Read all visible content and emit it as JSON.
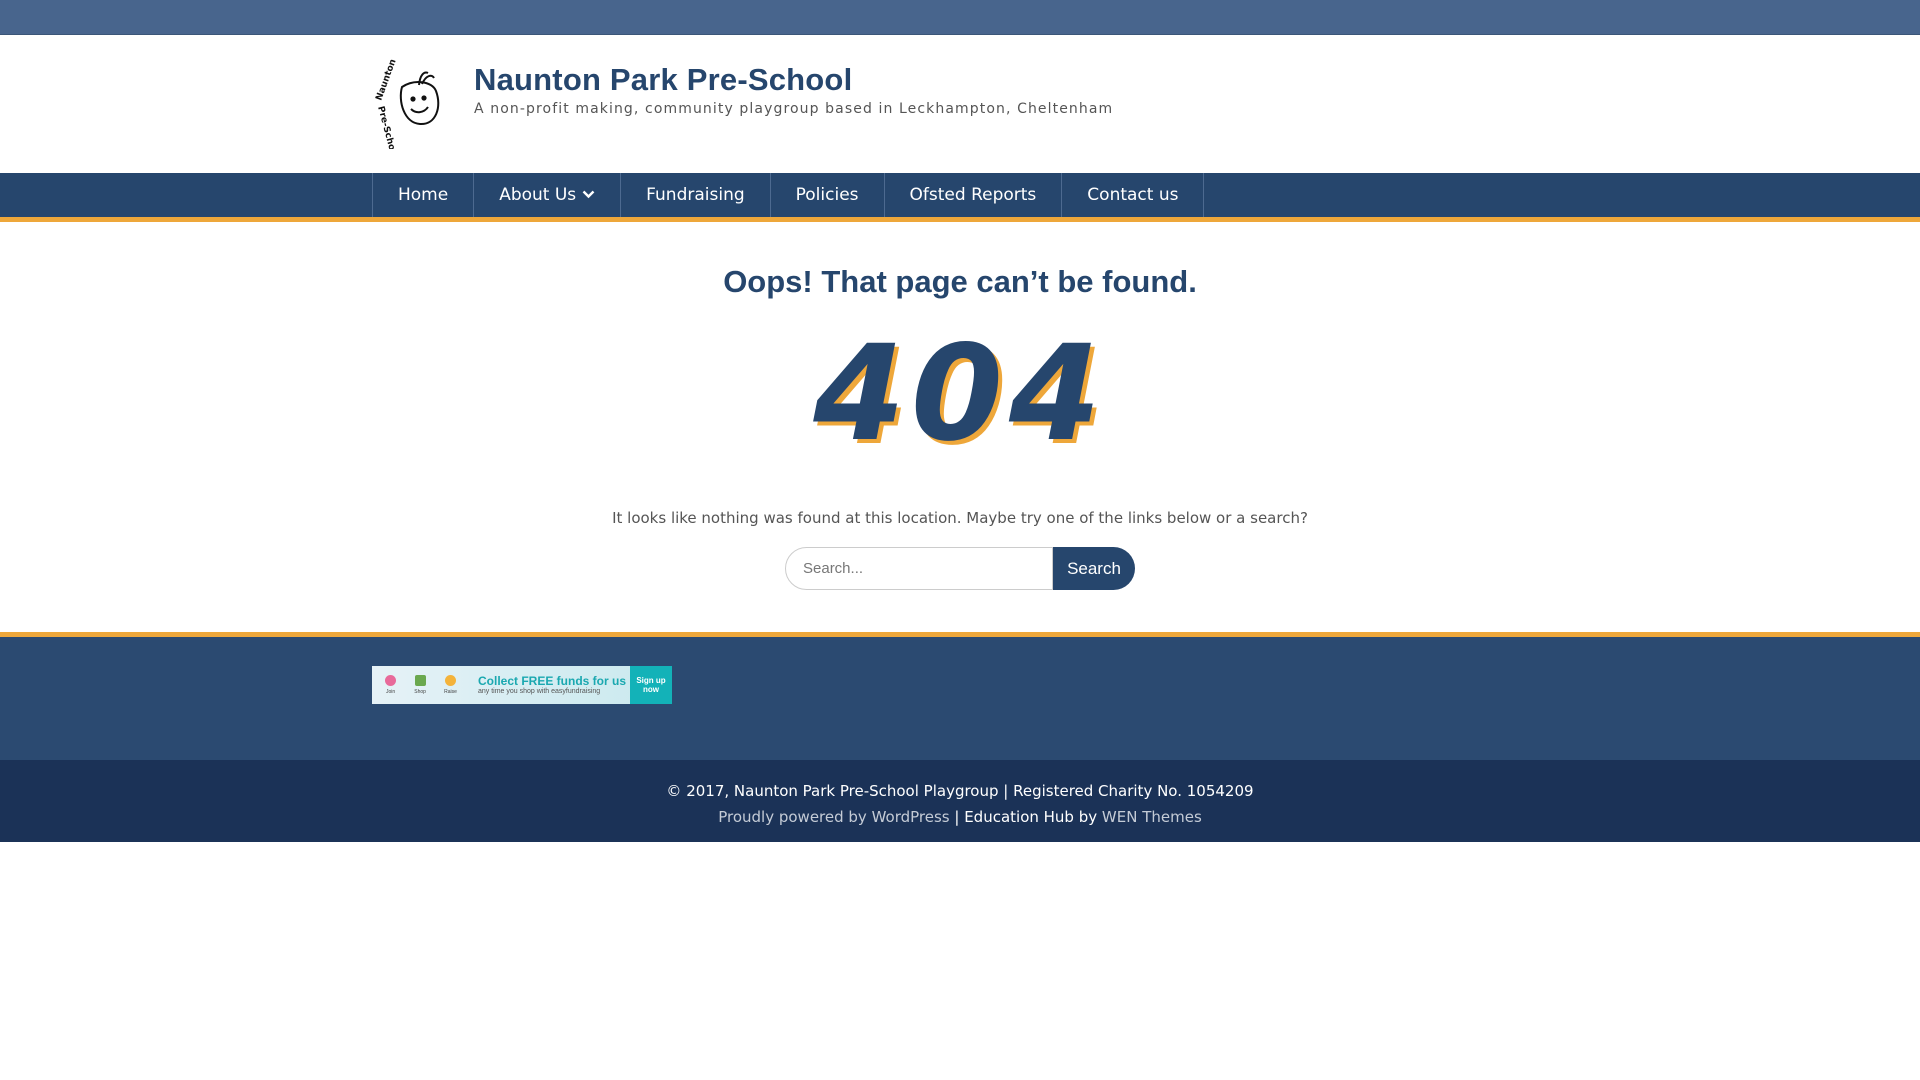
{
  "site": {
    "title": "Naunton Park Pre-School",
    "description": "A non-profit making, community playgroup based in Leckhampton, Cheltenham",
    "logo_text": "Naunton Park Pre-School Playgroup"
  },
  "nav": {
    "items": [
      {
        "label": "Home"
      },
      {
        "label": "About Us",
        "has_submenu": true
      },
      {
        "label": "Fundraising"
      },
      {
        "label": "Policies"
      },
      {
        "label": "Ofsted Reports"
      },
      {
        "label": "Contact us"
      }
    ]
  },
  "error": {
    "title": "Oops! That page can’t be found.",
    "code": "404",
    "message": "It looks like nothing was found at this location. Maybe try one of the links below or a search?"
  },
  "search": {
    "placeholder": "Search...",
    "value": "",
    "button_label": "Search"
  },
  "banner": {
    "steps": [
      "Join",
      "Shop",
      "Raise"
    ],
    "headline": "Collect FREE funds for us",
    "subline": "any time you shop with easyfundraising",
    "cta": "Sign up now"
  },
  "footer": {
    "copyright": "© 2017, Naunton Park Pre-School Playgroup | Registered Charity No. 1054209",
    "powered_by": "Proudly powered by WordPress",
    "separator": " | ",
    "theme_name": "Education Hub by ",
    "theme_author": "WEN Themes"
  },
  "colors": {
    "topbar": "#48658d",
    "primary": "#26466d",
    "accent": "#eea73a",
    "footer_widgets": "#2b4a71",
    "footer_bottom": "#1b3257"
  }
}
